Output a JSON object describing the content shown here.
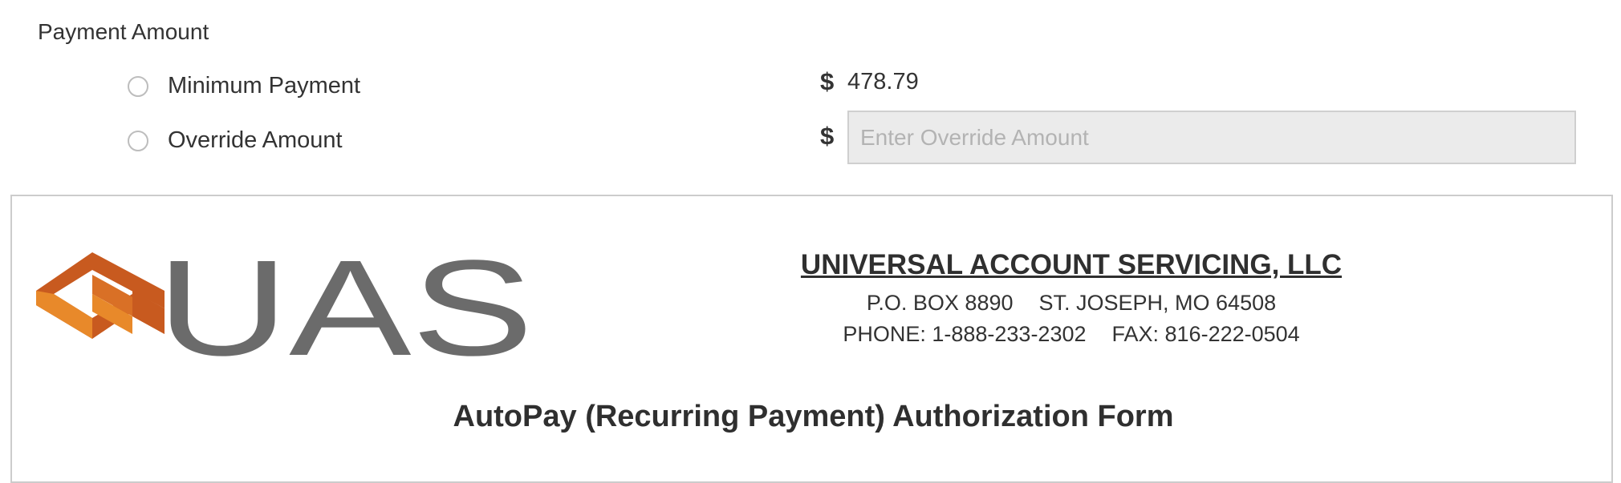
{
  "payment": {
    "section_label": "Payment Amount",
    "options": [
      {
        "label": "Minimum Payment",
        "currency": "$",
        "value": "478.79"
      },
      {
        "label": "Override Amount",
        "currency": "$",
        "placeholder": "Enter Override Amount",
        "value": ""
      }
    ]
  },
  "form_header": {
    "logo_text": "UAS",
    "company_name": "UNIVERSAL ACCOUNT SERVICING, LLC",
    "po_box": "P.O. BOX 8890",
    "city": "ST. JOSEPH, MO 64508",
    "phone": "PHONE: 1-888-233-2302",
    "fax": "FAX: 816-222-0504",
    "title": "AutoPay (Recurring Payment) Authorization Form",
    "logo_colors": {
      "orange_dark": "#c85a1f",
      "orange_light": "#e8892a",
      "gray": "#6b6b6b"
    }
  }
}
